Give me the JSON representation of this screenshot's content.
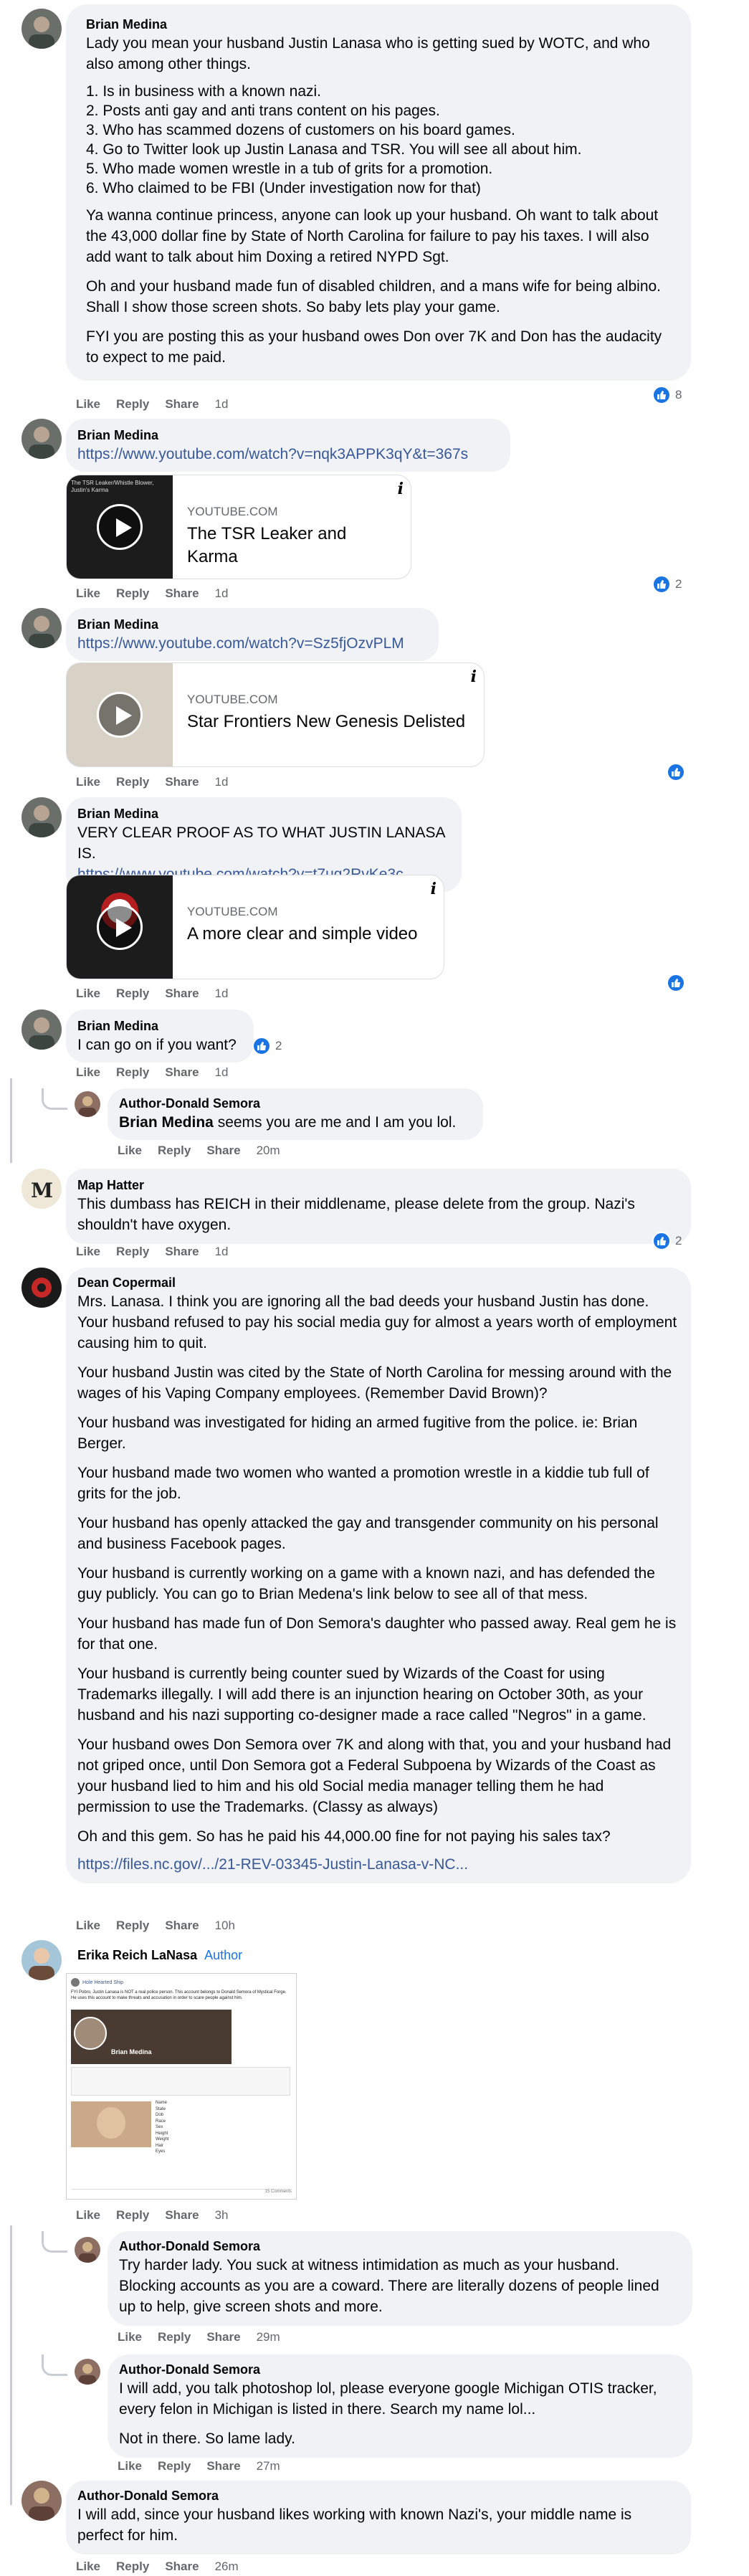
{
  "actions": {
    "like": "Like",
    "reply": "Reply",
    "share": "Share"
  },
  "c1": {
    "name": "Brian Medina",
    "lines": [
      "Lady you mean your husband Justin Lanasa who is getting sued by WOTC, and who also among other things."
    ],
    "list": [
      "1. Is in business with a known nazi.",
      "2. Posts anti gay and anti trans content on his pages.",
      "3. Who has scammed dozens of customers on his board games.",
      "4. Go to Twitter look up Justin Lanasa and TSR. You will see all about him.",
      "5. Who made women wrestle in a tub of grits for a promotion.",
      "6. Who claimed to be FBI (Under investigation now for that)"
    ],
    "p2": "Ya wanna continue princess, anyone can look up your husband. Oh want to talk about the 43,000 dollar fine by State of North Carolina for failure to pay his taxes. I will also add want to talk about him Doxing a retired NYPD Sgt.",
    "p3": "Oh and your husband made fun of disabled children, and a mans wife for being albino. Shall I show those screen shots. So baby lets play your game.",
    "p4": "FYI you are posting this as your husband owes Don over 7K and Don has the audacity to expect to me paid.",
    "time": "1d",
    "reacts": "8"
  },
  "c2": {
    "name": "Brian Medina",
    "link": "https://www.youtube.com/watch?v=nqk3APPK3qY&t=367s",
    "card_site": "YOUTUBE.COM",
    "card_title": "The TSR Leaker and Karma",
    "thumb_text": "The TSR Leaker/Whistle Blower, Justin's Karma",
    "time": "1d",
    "reacts": "2"
  },
  "c3": {
    "name": "Brian Medina",
    "link": "https://www.youtube.com/watch?v=Sz5fjOzvPLM",
    "card_site": "YOUTUBE.COM",
    "card_title": "Star Frontiers New Genesis Delisted",
    "time": "1d"
  },
  "c4": {
    "name": "Brian Medina",
    "text": "VERY CLEAR PROOF AS TO WHAT JUSTIN LANASA IS.",
    "link": "https://www.youtube.com/watch?v=t7ug2RvKe3c",
    "card_site": "YOUTUBE.COM",
    "card_title": "A more clear and simple video",
    "time": "1d"
  },
  "c5": {
    "name": "Brian Medina",
    "text": "I can go on if you want?",
    "time": "1d",
    "reacts": "2"
  },
  "r5": {
    "name": "Author-Donald Semora",
    "mention": "Brian Medina",
    "text": " seems you are me and I am you lol.",
    "time": "20m"
  },
  "c6": {
    "name": "Map Hatter",
    "text": "This dumbass has REICH in their middlename, please delete from the group. Nazi's shouldn't have oxygen.",
    "time": "1d",
    "reacts": "2"
  },
  "c7": {
    "name": "Dean Copermail",
    "paras": [
      "Mrs. Lanasa. I think you are ignoring all the bad deeds your husband Justin has done. Your husband refused to pay his social media guy for almost a years worth of employment causing him to quit.",
      "Your husband Justin was cited by the State of North Carolina for messing around with the wages of his Vaping Company employees. (Remember David Brown)?",
      "Your husband was investigated for hiding an armed fugitive from the police. ie: Brian Berger.",
      "Your husband made two women who wanted a promotion wrestle in a kiddie tub full of grits for the job.",
      "Your husband has openly attacked the gay and transgender community on his personal and business Facebook pages.",
      "Your husband is currently working on a game with a known nazi, and has defended the guy publicly. You can go to Brian Medena's link below to see all of that mess.",
      "Your husband has made fun of Don Semora's daughter who passed away. Real gem he is for that one.",
      "Your husband is currently being counter sued by Wizards of the Coast for using Trademarks illegally. I will add there is an injunction hearing on October 30th, as your husband and his nazi supporting co-designer made a race called \"Negros\" in a game.",
      "Your husband owes Don Semora over 7K and along with that, you and your husband had not griped once, until Don Semora got a Federal Subpoena by Wizards of the Coast as your husband lied to him and his old Social media manager telling them he had permission to use the Trademarks. (Classy as always)",
      "Oh and this gem. So has he paid his 44,000.00 fine for not paying his sales tax?"
    ],
    "link": "https://files.nc.gov/.../21-REV-03345-Justin-Lanasa-v-NC...",
    "time": "10h"
  },
  "c8": {
    "name": "Erika Reich LaNasa",
    "badge": "Author",
    "time": "3h",
    "shot_header": "Brian Medina",
    "shot_page": "Hole Hearted Ship",
    "shot_text": "FYI Pobro, Justin Lanasa is NOT a real police person. This account belongs to Donald Semora of Mystical Forge. He uses this account to make threats and accusation in order to scare people against him.",
    "shot_rows": [
      "Name",
      "State",
      "Dob",
      "Race",
      "Sex",
      "Height",
      "Weight",
      "Hair",
      "Eyes"
    ],
    "shot_footer": "15 Comments"
  },
  "r8a": {
    "name": "Author-Donald Semora",
    "text": "Try harder lady. You suck at witness intimidation as much as your husband. Blocking accounts as you are a coward. There are literally dozens of people lined up to help, give screen shots and more.",
    "time": "29m"
  },
  "r8b": {
    "name": "Author-Donald Semora",
    "text": "I will add, you talk photoshop lol, please everyone google Michigan OTIS tracker, every felon in Michigan is listed in there. Search my name lol...",
    "text2": "Not in there. So lame lady.",
    "time": "27m"
  },
  "c9": {
    "name": "Author-Donald Semora",
    "text": "I will add, since your husband likes working with known Nazi's, your middle name is perfect for him.",
    "time": "26m"
  }
}
